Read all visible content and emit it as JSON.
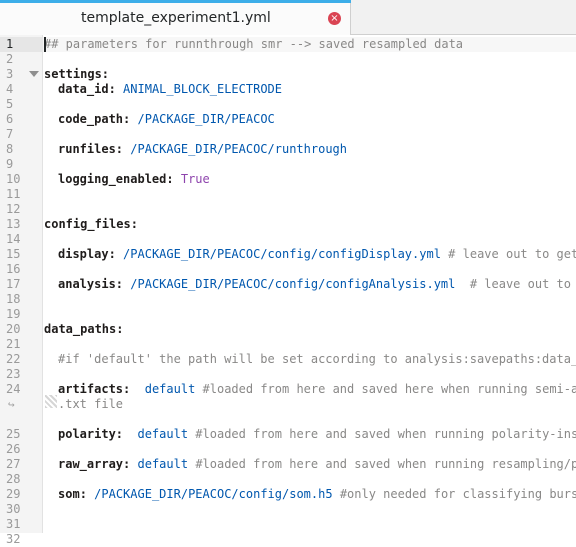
{
  "tab": {
    "title": "template_experiment1.yml",
    "close_glyph": "×",
    "accent_color": "#3daee9",
    "close_color": "#da4453"
  },
  "gutter": {
    "line_numbers": [
      "1",
      "2",
      "3",
      "4",
      "5",
      "6",
      "7",
      "8",
      "9",
      "10",
      "11",
      "12",
      "13",
      "14",
      "15",
      "16",
      "17",
      "18",
      "19",
      "20",
      "21",
      "22",
      "23",
      "24",
      "25",
      "26",
      "27",
      "28",
      "29",
      "30",
      "31",
      "32"
    ],
    "wrap_glyph": "↪",
    "fold_icon": "triangle-down-icon"
  },
  "code": {
    "l1": "## parameters for runnthrough smr --> saved resampled data",
    "l3_key": "settings",
    "l4_key": "data_id",
    "l4_val": "ANIMAL_BLOCK_ELECTRODE",
    "l6_key": "code_path",
    "l6_val": "/PACKAGE_DIR/PEACOC",
    "l8_key": "runfiles",
    "l8_val": "/PACKAGE_DIR/PEACOC/runthrough",
    "l10_key": "logging_enabled",
    "l10_val": "True",
    "l13_key": "config_files",
    "l15_key": "display",
    "l15_val": "/PACKAGE_DIR/PEACOC/config/configDisplay.yml",
    "l15_cm": "# leave out to get",
    "l17_key": "analysis",
    "l17_val": "/PACKAGE_DIR/PEACOC/config/configAnalysis.yml",
    "l17_cm": "# leave out to g",
    "l20_key": "data_paths",
    "l22_cm": "#if 'default' the path will be set according to analysis:savepaths:data_",
    "l24_key": "artifacts",
    "l24_val": "default",
    "l24_cm": "#loaded from here and saved here when running semi-a",
    "l24_wrap": ".txt file",
    "l26_key": "polarity",
    "l26_val": "default",
    "l26_cm": "#loaded from here and saved when running polarity-ins",
    "l28_key": "raw_array",
    "l28_val": "default",
    "l28_cm": "#loaded from here and saved when running resampling/p",
    "l30_key": "som",
    "l30_val": "/PACKAGE_DIR/PEACOC/config/som.h5",
    "l30_cm": "#only needed for classifying burs",
    "colon": ":"
  }
}
